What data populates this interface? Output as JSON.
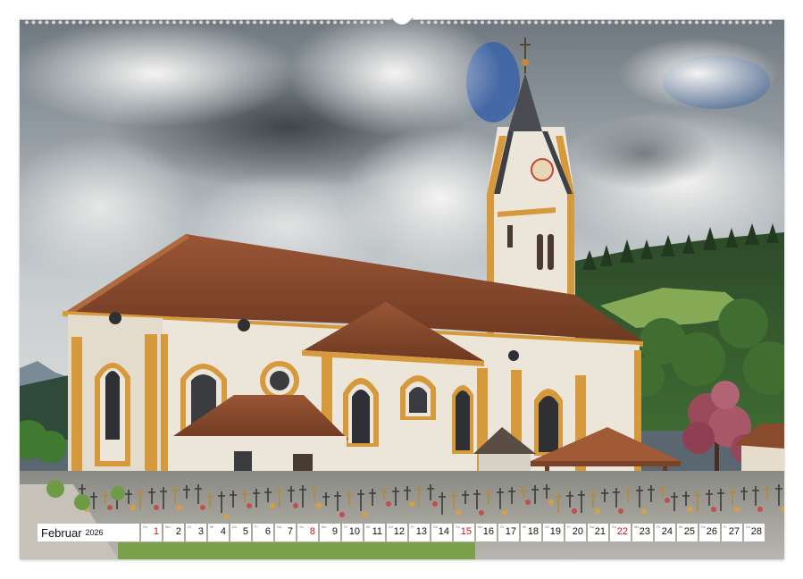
{
  "calendar": {
    "month": "Februar",
    "year": "2026",
    "days": [
      {
        "num": "1",
        "wd": "So",
        "sun": true
      },
      {
        "num": "2",
        "wd": "Mo"
      },
      {
        "num": "3",
        "wd": "Di"
      },
      {
        "num": "4",
        "wd": "Mi"
      },
      {
        "num": "5",
        "wd": "Do"
      },
      {
        "num": "6",
        "wd": "Fr"
      },
      {
        "num": "7",
        "wd": "Sa"
      },
      {
        "num": "8",
        "wd": "So",
        "sun": true
      },
      {
        "num": "9",
        "wd": "Mo"
      },
      {
        "num": "10",
        "wd": "Di"
      },
      {
        "num": "11",
        "wd": "Mi"
      },
      {
        "num": "12",
        "wd": "Do"
      },
      {
        "num": "13",
        "wd": "Fr"
      },
      {
        "num": "14",
        "wd": "Sa"
      },
      {
        "num": "15",
        "wd": "So",
        "sun": true
      },
      {
        "num": "16",
        "wd": "Mo"
      },
      {
        "num": "17",
        "wd": "Di"
      },
      {
        "num": "18",
        "wd": "Mi"
      },
      {
        "num": "19",
        "wd": "Do"
      },
      {
        "num": "20",
        "wd": "Fr"
      },
      {
        "num": "21",
        "wd": "Sa"
      },
      {
        "num": "22",
        "wd": "So",
        "sun": true
      },
      {
        "num": "23",
        "wd": "Mo"
      },
      {
        "num": "24",
        "wd": "Di"
      },
      {
        "num": "25",
        "wd": "Mi"
      },
      {
        "num": "26",
        "wd": "Do"
      },
      {
        "num": "27",
        "wd": "Fr"
      },
      {
        "num": "28",
        "wd": "Sa"
      }
    ]
  },
  "colors": {
    "sunday": "#c4141c",
    "facade": "#ece6da",
    "trim": "#d69a3c",
    "roof": "#8a4a2c"
  }
}
